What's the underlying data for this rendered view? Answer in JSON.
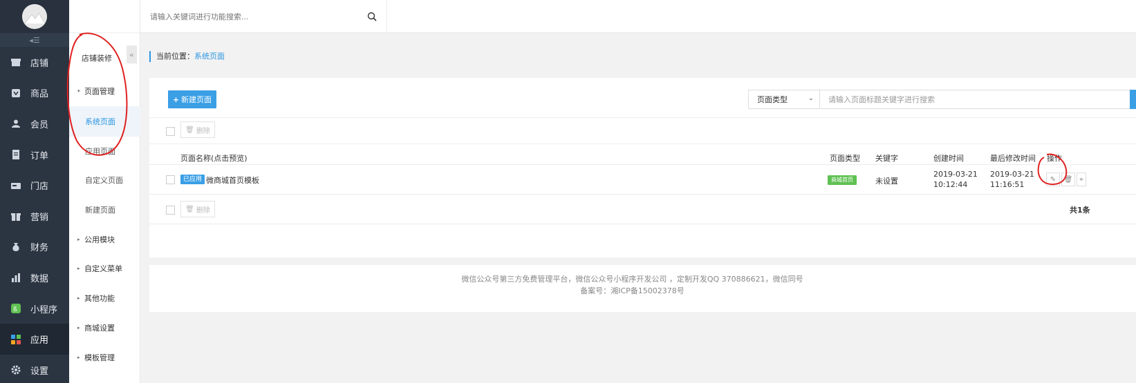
{
  "nav": {
    "items": [
      {
        "label": "店铺",
        "icon": "store-icon"
      },
      {
        "label": "商品",
        "icon": "goods-icon"
      },
      {
        "label": "会员",
        "icon": "user-icon"
      },
      {
        "label": "订单",
        "icon": "order-icon"
      },
      {
        "label": "门店",
        "icon": "shop-icon"
      },
      {
        "label": "营销",
        "icon": "marketing-icon"
      },
      {
        "label": "财务",
        "icon": "money-bag-icon"
      },
      {
        "label": "数据",
        "icon": "bar-chart-icon"
      },
      {
        "label": "小程序",
        "icon": "mini-program-icon"
      },
      {
        "label": "应用",
        "icon": "apps-grid-icon"
      },
      {
        "label": "设置",
        "icon": "gear-icon"
      }
    ],
    "active_index": 9,
    "collapse_glyph": "◂☰"
  },
  "submenu": {
    "title": "店铺装修",
    "collapse_glyph": "«",
    "items": [
      {
        "label": "页面管理",
        "group": true,
        "caret": "▾"
      },
      {
        "label": "系统页面",
        "group": false,
        "active": true
      },
      {
        "label": "应用页面",
        "group": false
      },
      {
        "label": "自定义页面",
        "group": false
      },
      {
        "label": "新建页面",
        "group": false
      },
      {
        "label": "公用模块",
        "group": true,
        "caret": "▸"
      },
      {
        "label": "自定义菜单",
        "group": true,
        "caret": "▸"
      },
      {
        "label": "其他功能",
        "group": true,
        "caret": "▸"
      },
      {
        "label": "商城设置",
        "group": true,
        "caret": "▸"
      },
      {
        "label": "模板管理",
        "group": true,
        "caret": "▸"
      }
    ]
  },
  "topbar": {
    "search_placeholder": "请输入关键词进行功能搜索..."
  },
  "breadcrumb": {
    "prefix": "当前位置：",
    "current": "系统页面"
  },
  "toolbar": {
    "new_page_label": "新建页面",
    "filter_select_value": "页面类型",
    "filter_placeholder": "请输入页面标题关键字进行搜索",
    "delete_label": "删除"
  },
  "table": {
    "headers": [
      "页面名称(点击预览)",
      "页面类型",
      "关键字",
      "创建时间",
      "最后修改时间",
      "操作"
    ],
    "rows": [
      {
        "status_badge": "已应用",
        "name": "微商城首页模板",
        "type_badge": "商城首页",
        "keyword": "未设置",
        "created_date": "2019-03-21",
        "created_time": "10:12:44",
        "modified_date": "2019-03-21",
        "modified_time": "11:16:51"
      }
    ],
    "total_text": "共1条"
  },
  "footer": {
    "line1": "微信公众号第三方免费管理平台，微信公众号小程序开发公司 ，定制开发QQ 370886621，微信同号",
    "line2": "备案号：湘ICP备15002378号"
  },
  "colors": {
    "sidebar_bg": "#2b3542",
    "accent": "#3b9fe6",
    "badge_green": "#5fc152",
    "annotation_red": "#e02020"
  }
}
